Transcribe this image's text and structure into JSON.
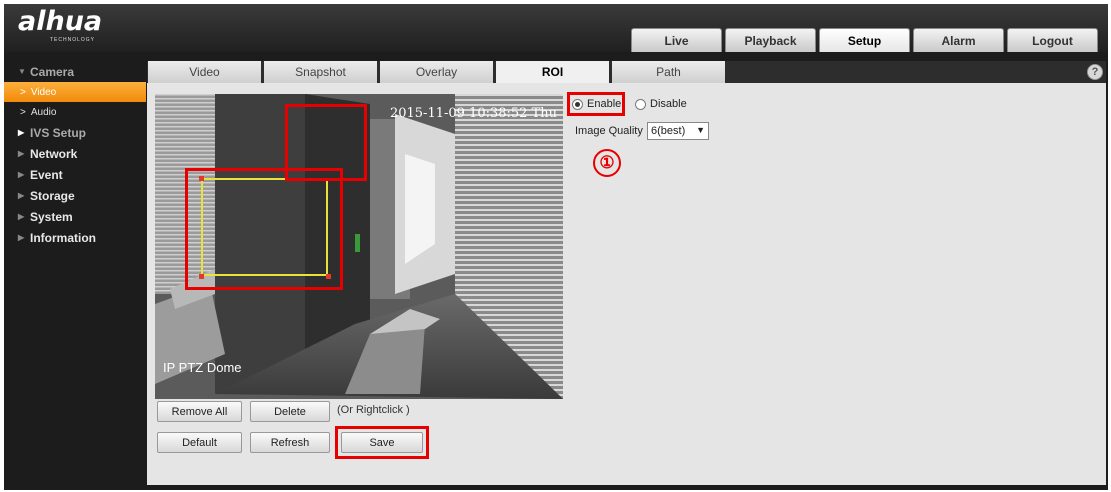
{
  "brand": {
    "logo_text": "alhua",
    "logo_sub": "TECHNOLOGY"
  },
  "topnav": [
    {
      "label": "Live",
      "active": false
    },
    {
      "label": "Playback",
      "active": false
    },
    {
      "label": "Setup",
      "active": true
    },
    {
      "label": "Alarm",
      "active": false
    },
    {
      "label": "Logout",
      "active": false
    }
  ],
  "sidebar": {
    "camera": "Camera",
    "video": "Video",
    "audio": "Audio",
    "ivs_setup": "IVS Setup",
    "network": "Network",
    "event": "Event",
    "storage": "Storage",
    "system": "System",
    "information": "Information"
  },
  "tabs": [
    {
      "label": "Video",
      "active": false
    },
    {
      "label": "Snapshot",
      "active": false
    },
    {
      "label": "Overlay",
      "active": false
    },
    {
      "label": "ROI",
      "active": true
    },
    {
      "label": "Path",
      "active": false
    }
  ],
  "help_icon": "?",
  "video": {
    "timestamp": "2015-11-09 10:38:52 Thu",
    "channel_name": "IP PTZ Dome"
  },
  "buttons": {
    "remove_all": "Remove All",
    "delete": "Delete",
    "delete_note": "(Or Rightclick )",
    "default": "Default",
    "refresh": "Refresh",
    "save": "Save"
  },
  "roi": {
    "enable_label": "Enable",
    "disable_label": "Disable",
    "enabled": true,
    "image_quality_label": "Image Quality",
    "image_quality_value": "6(best)"
  },
  "annotation": {
    "step_marker": "①"
  },
  "colors": {
    "accent_orange": "#f28a0b",
    "annotation_red": "#e60000",
    "roi_yellow": "#e8e23a"
  }
}
